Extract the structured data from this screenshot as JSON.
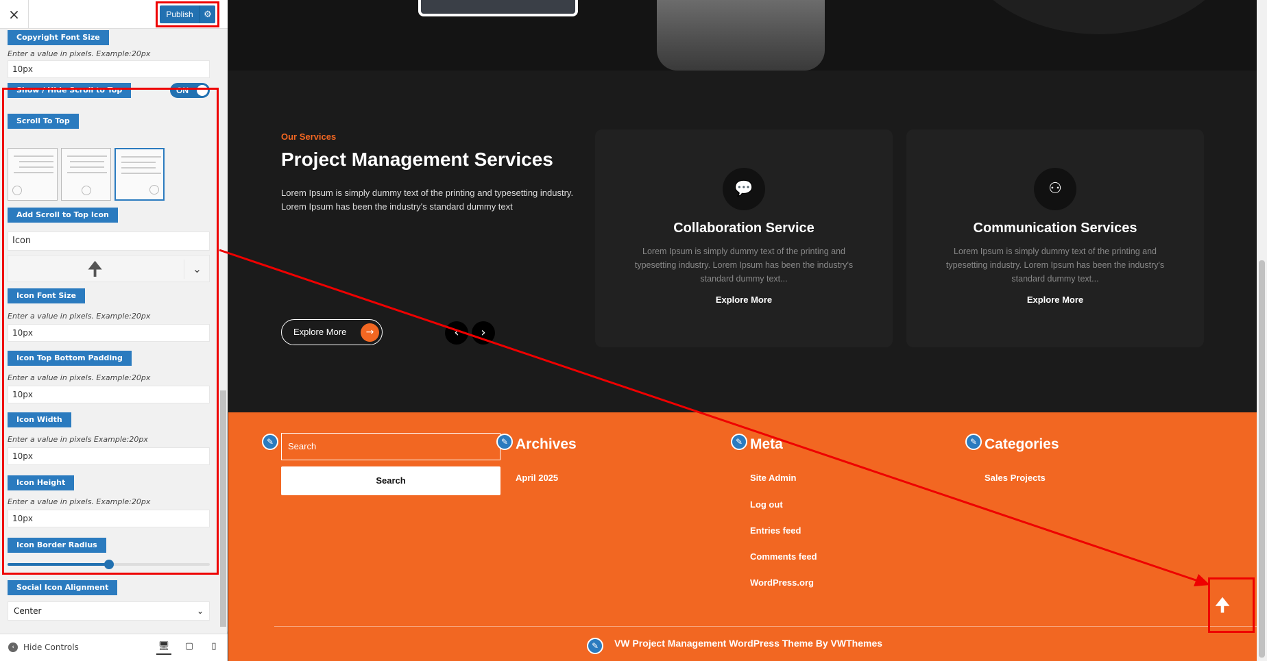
{
  "sidebar": {
    "close_icon": "×",
    "publish_label": "Publish",
    "publish_gear_icon": "⚙",
    "sections": {
      "copyright_font_size": "Copyright Font Size",
      "copyright_hint": "Enter a value in pixels. Example:20px",
      "copyright_value": "10px",
      "show_hide_scroll": "Show / Hide Scroll to Top",
      "toggle_state": "ON",
      "scroll_to_top": "Scroll To Top",
      "add_scroll_icon": "Add Scroll to Top Icon",
      "icon_field": "Icon",
      "icon_preview": "🠉",
      "icon_chevron": "⌄",
      "icon_font_size": "Icon Font Size",
      "icon_font_size_hint": "Enter a value in pixels. Example:20px",
      "icon_font_size_value": "10px",
      "icon_top_bottom_padding": "Icon Top Bottom Padding",
      "icon_padding_hint": "Enter a value in pixels. Example:20px",
      "icon_padding_value": "10px",
      "icon_width": "Icon Width",
      "icon_width_hint": "Enter a value in pixels Example:20px",
      "icon_width_value": "10px",
      "icon_height": "Icon Height",
      "icon_height_hint": "Enter a value in pixels. Example:20px",
      "icon_height_value": "10px",
      "icon_border_radius": "Icon Border Radius",
      "border_radius_fraction": 0.5,
      "social_icon_alignment": "Social Icon Alignment",
      "alignment_value": "Center",
      "alignment_chevron": "⌄"
    },
    "selected_layout": 3,
    "footer": {
      "hide_controls": "Hide Controls",
      "hide_icon": "‹",
      "desktop_icon": "🖥",
      "tablet_icon": "▢",
      "mobile_icon": "▯"
    }
  },
  "preview": {
    "services": {
      "eyebrow": "Our Services",
      "title": "Project Management Services",
      "description": "Lorem Ipsum is simply dummy text of the printing and typesetting industry. Lorem Ipsum has been the industry's standard dummy text",
      "explore_label": "Explore More",
      "explore_arrow": "→",
      "prev_arrow": "‹",
      "next_arrow": "›",
      "cards": [
        {
          "icon": "💬",
          "title": "Collaboration Service",
          "text": "Lorem Ipsum is simply dummy text of the printing and typesetting industry. Lorem Ipsum has been the industry's standard dummy text...",
          "more": "Explore More"
        },
        {
          "icon": "⚇",
          "title": "Communication Services",
          "text": "Lorem Ipsum is simply dummy text of the printing and typesetting industry. Lorem Ipsum has been the industry's standard dummy text...",
          "more": "Explore More"
        }
      ]
    },
    "footer": {
      "search_placeholder": "Search",
      "search_button": "Search",
      "pencil_icon": "✎",
      "archives_title": "Archives",
      "archives": [
        "April 2025"
      ],
      "meta_title": "Meta",
      "meta": [
        "Site Admin",
        "Log out",
        "Entries feed",
        "Comments feed",
        "WordPress.org"
      ],
      "categories_title": "Categories",
      "categories": [
        "Sales Projects"
      ],
      "copyright": "VW Project Management WordPress Theme By VWThemes",
      "scroll_top_icon": "🠉"
    }
  },
  "colors": {
    "accent_blue": "#2271b1",
    "brand_orange": "#f26722",
    "annotation_red": "#ee0000"
  }
}
